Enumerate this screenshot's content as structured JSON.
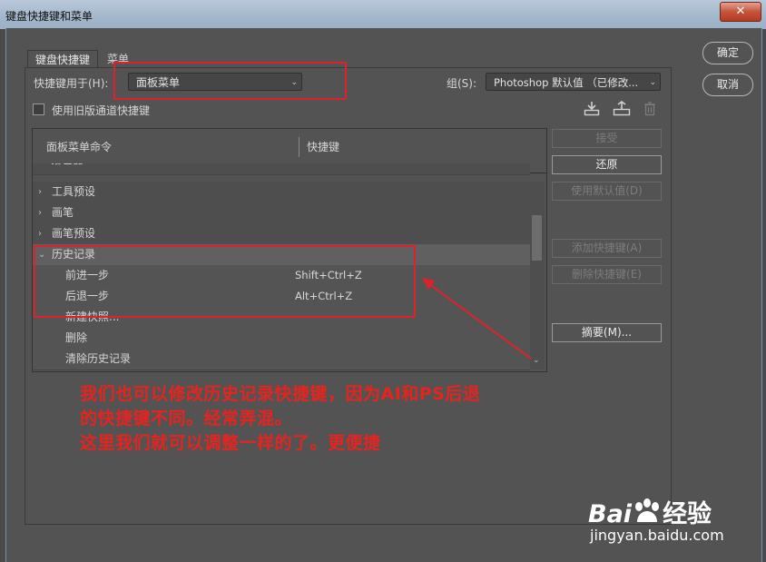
{
  "window": {
    "title": "键盘快捷键和菜单",
    "close_label": "✕"
  },
  "tabs": [
    {
      "label": "键盘快捷键"
    },
    {
      "label": "菜单"
    }
  ],
  "shortcuts_for": {
    "label": "快捷键用于(H):",
    "value": "面板菜单"
  },
  "group": {
    "label": "组(S):",
    "value": "Photoshop 默认值 （已修改..."
  },
  "legacy_checkbox": {
    "label": "使用旧版通道快捷键",
    "checked": false
  },
  "table": {
    "col_command": "面板菜单命令",
    "col_shortcut": "快捷键",
    "partial_row": "拾色器",
    "rows": [
      {
        "label": "工具预设",
        "shortcut": "",
        "expand": "›"
      },
      {
        "label": "画笔",
        "shortcut": "",
        "expand": "›"
      },
      {
        "label": "画笔预设",
        "shortcut": "",
        "expand": "›"
      },
      {
        "label": "历史记录",
        "shortcut": "",
        "expand": "⌄"
      },
      {
        "label": "前进一步",
        "shortcut": "Shift+Ctrl+Z"
      },
      {
        "label": "后退一步",
        "shortcut": "Alt+Ctrl+Z"
      },
      {
        "label": "新建快照...",
        "shortcut": ""
      },
      {
        "label": "删除",
        "shortcut": ""
      },
      {
        "label": "清除历史记录",
        "shortcut": ""
      }
    ]
  },
  "side_buttons": {
    "accept": "接受",
    "undo": "还原",
    "use_default": "使用默认值(D)",
    "add_shortcut": "添加快捷键(A)",
    "delete_shortcut": "删除快捷键(E)",
    "summary": "摘要(M)..."
  },
  "dialog_buttons": {
    "ok": "确定",
    "cancel": "取消"
  },
  "annotation": {
    "line1": "我们也可以修改历史记录快捷键，因为AI和PS后退",
    "line2": "的快捷键不同。经常弄混。",
    "line3": "这里我们就可以调整一样的了。更便捷"
  },
  "watermark": {
    "brand": "Bai",
    "brand2": "经验",
    "url": "jingyan.baidu.com"
  },
  "colors": {
    "annotation_red": "#e5241f",
    "dialog_bg": "#535353"
  },
  "icons": [
    "save-icon",
    "new-set-icon",
    "trash-icon",
    "chevron-right-icon",
    "chevron-down-icon"
  ]
}
